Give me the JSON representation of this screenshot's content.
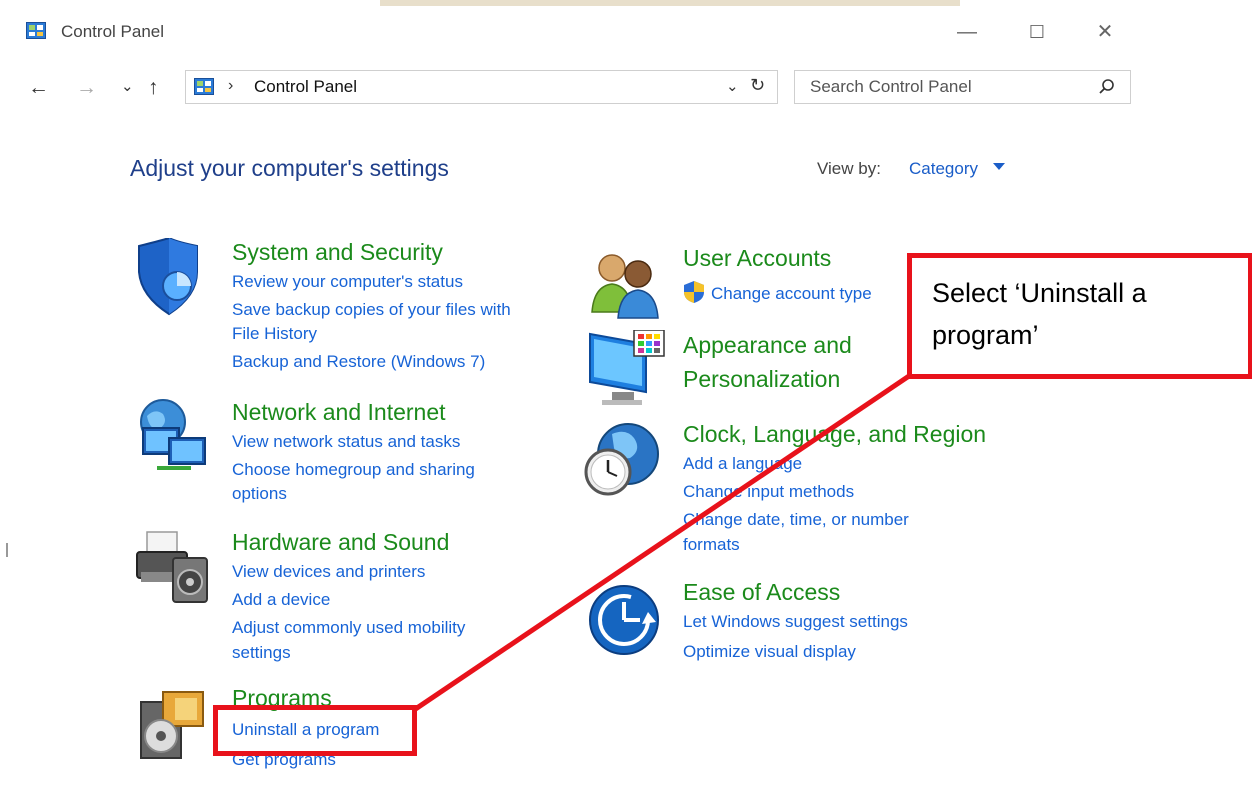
{
  "window": {
    "title": "Control Panel",
    "minimize_label": "—",
    "maximize_label": "☐",
    "close_label": "✕"
  },
  "nav": {
    "back_label": "←",
    "forward_label": "→",
    "recent_label": "⌄",
    "up_label": "↑"
  },
  "address": {
    "separator": "›",
    "path": "Control Panel",
    "dropdown_label": "⌄",
    "refresh_label": "↻"
  },
  "search": {
    "placeholder": "Search Control Panel"
  },
  "main": {
    "title": "Adjust your computer's settings",
    "view_by_label": "View by:",
    "view_by_value": "Category"
  },
  "left_categories": [
    {
      "title": "System and Security",
      "icon": "shield-icon",
      "links": [
        "Review your computer's status",
        "Save backup copies of your files with",
        "File History",
        "Backup and Restore (Windows 7)"
      ]
    },
    {
      "title": "Network and Internet",
      "icon": "network-icon",
      "links": [
        "View network status and tasks",
        "Choose homegroup and sharing",
        "options"
      ]
    },
    {
      "title": "Hardware and Sound",
      "icon": "printer-icon",
      "links": [
        "View devices and printers",
        "Add a device",
        "Adjust commonly used mobility",
        "settings"
      ]
    },
    {
      "title": "Programs",
      "icon": "programs-icon",
      "links": [
        "Uninstall a program",
        "Get programs"
      ]
    }
  ],
  "right_categories": [
    {
      "title": "User Accounts",
      "icon": "users-icon",
      "links": [
        "Change account type"
      ]
    },
    {
      "title": "Appearance and",
      "title2": "Personalization",
      "icon": "monitor-icon",
      "links": []
    },
    {
      "title": "Clock, Language, and Region",
      "icon": "clock-globe-icon",
      "links": [
        "Add a language",
        "Change input methods",
        "Change date, time, or number",
        "formats"
      ]
    },
    {
      "title": "Ease of Access",
      "icon": "ease-of-access-icon",
      "links": [
        "Let Windows suggest settings",
        "Optimize visual display"
      ]
    }
  ],
  "annotation": {
    "text": "Select ‘Uninstall a program’",
    "color": "#e8121b"
  },
  "colors": {
    "category_title": "#1b8a1b",
    "link": "#1763d6",
    "heading": "#1f3f8a"
  }
}
